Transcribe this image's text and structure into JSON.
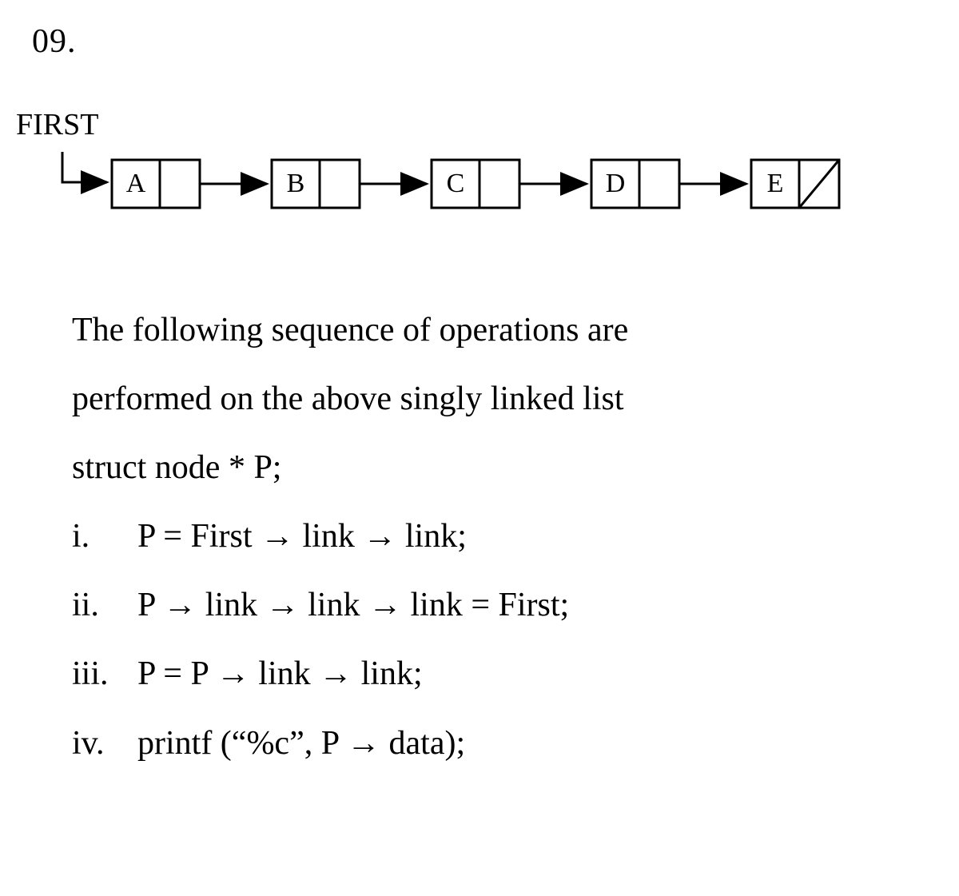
{
  "question_number": "09.",
  "first_label": "FIRST",
  "nodes": [
    "A",
    "B",
    "C",
    "D",
    "E"
  ],
  "paragraph_line1": "The following sequence of operations are",
  "paragraph_line2": "performed on the above singly linked list",
  "decl": "struct node  * P;",
  "arrow_glyph": "→",
  "steps": [
    {
      "label": "i.",
      "text": "P =  First → link → link;"
    },
    {
      "label": "ii.",
      "text": "P → link → link → link = First;"
    },
    {
      "label": "iii.",
      "text": "P = P → link → link;"
    },
    {
      "label": "iv.",
      "text": "printf (“%c”, P → data);"
    }
  ]
}
